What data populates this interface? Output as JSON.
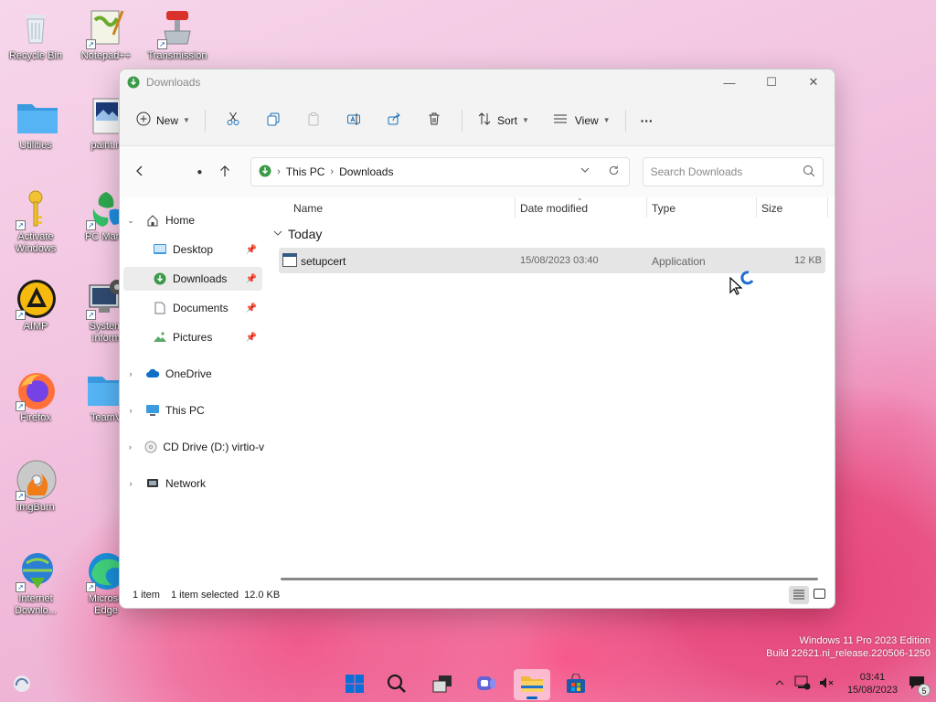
{
  "desktop": {
    "icons": [
      {
        "label": "Recycle Bin"
      },
      {
        "label": "Notepad++"
      },
      {
        "label": "Transmission"
      },
      {
        "label": "Utilities"
      },
      {
        "label": "paint.n"
      },
      {
        "label": "Activate Windows"
      },
      {
        "label": "PC Mana"
      },
      {
        "label": "AIMP"
      },
      {
        "label": "System Inform"
      },
      {
        "label": "Firefox"
      },
      {
        "label": "TeamV"
      },
      {
        "label": "ImgBurn"
      },
      {
        "label": "Internet Downlo..."
      },
      {
        "label": "Microso Edge"
      }
    ]
  },
  "window": {
    "title": "Downloads",
    "commands": {
      "new": "New",
      "sort": "Sort",
      "view": "View",
      "more": "···"
    },
    "address": {
      "crumbs": [
        "This PC",
        "Downloads"
      ]
    },
    "search": {
      "placeholder": "Search Downloads"
    },
    "sidebar": {
      "home": "Home",
      "desktop": "Desktop",
      "downloads": "Downloads",
      "documents": "Documents",
      "pictures": "Pictures",
      "onedrive": "OneDrive",
      "thispc": "This PC",
      "cddrive": "CD Drive (D:) virtio-v",
      "network": "Network"
    },
    "columns": {
      "name": "Name",
      "date": "Date modified",
      "type": "Type",
      "size": "Size"
    },
    "group": "Today",
    "files": [
      {
        "name": "setupcert",
        "date": "15/08/2023 03:40",
        "type": "Application",
        "size": "12 KB"
      }
    ],
    "status": {
      "count": "1 item",
      "selected": "1 item selected  12.0 KB"
    }
  },
  "watermark": {
    "line1": "Windows 11 Pro 2023 Edition",
    "line2": "Build 22621.ni_release.220506-1250"
  },
  "taskbar": {
    "time": "03:41",
    "date": "15/08/2023",
    "notifications": "5"
  },
  "colors": {
    "accent": "#0067c0",
    "folder": "#f8c94a",
    "download_green": "#3c9a4a"
  }
}
